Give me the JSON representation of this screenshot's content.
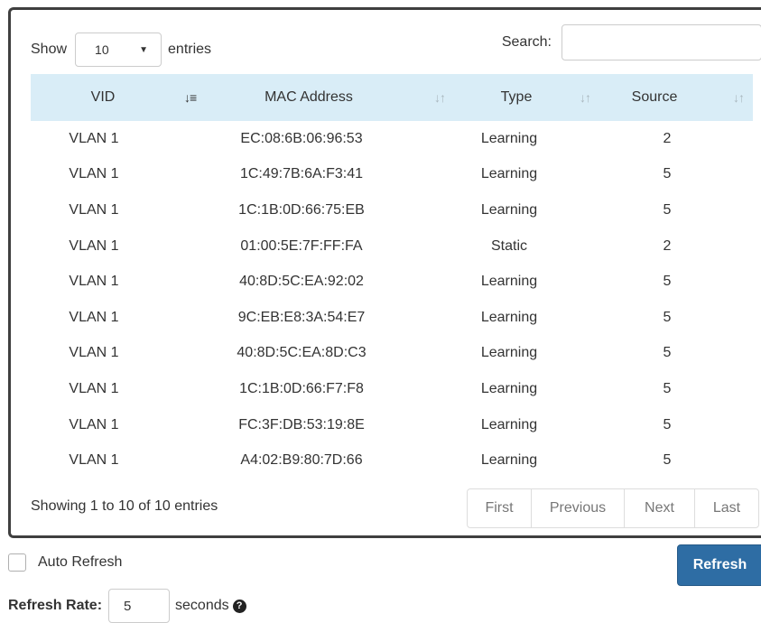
{
  "length_menu": {
    "prefix": "Show",
    "value": "10",
    "suffix": "entries"
  },
  "search": {
    "label": "Search:",
    "value": ""
  },
  "table": {
    "columns": [
      "VID",
      "MAC Address",
      "Type",
      "Source"
    ],
    "sort_icon_active": "sort-amount-down-icon",
    "sort_icon_inactive": "sort-both-icon",
    "rows": [
      [
        "VLAN 1",
        "EC:08:6B:06:96:53",
        "Learning",
        "2"
      ],
      [
        "VLAN 1",
        "1C:49:7B:6A:F3:41",
        "Learning",
        "5"
      ],
      [
        "VLAN 1",
        "1C:1B:0D:66:75:EB",
        "Learning",
        "5"
      ],
      [
        "VLAN 1",
        "01:00:5E:7F:FF:FA",
        "Static",
        "2"
      ],
      [
        "VLAN 1",
        "40:8D:5C:EA:92:02",
        "Learning",
        "5"
      ],
      [
        "VLAN 1",
        "9C:EB:E8:3A:54:E7",
        "Learning",
        "5"
      ],
      [
        "VLAN 1",
        "40:8D:5C:EA:8D:C3",
        "Learning",
        "5"
      ],
      [
        "VLAN 1",
        "1C:1B:0D:66:F7:F8",
        "Learning",
        "5"
      ],
      [
        "VLAN 1",
        "FC:3F:DB:53:19:8E",
        "Learning",
        "5"
      ],
      [
        "VLAN 1",
        "A4:02:B9:80:7D:66",
        "Learning",
        "5"
      ]
    ]
  },
  "info": "Showing 1 to 10 of 10 entries",
  "pagination": {
    "first": "First",
    "previous": "Previous",
    "next": "Next",
    "last": "Last"
  },
  "auto_refresh": {
    "label": "Auto Refresh",
    "checked": false
  },
  "refresh_button": "Refresh",
  "refresh_rate": {
    "label": "Refresh Rate:",
    "value": "5",
    "unit": "seconds"
  },
  "colors": {
    "header_bg": "#d9edf7",
    "button_bg": "#2e6da4",
    "panel_border": "#3f3f3f"
  }
}
